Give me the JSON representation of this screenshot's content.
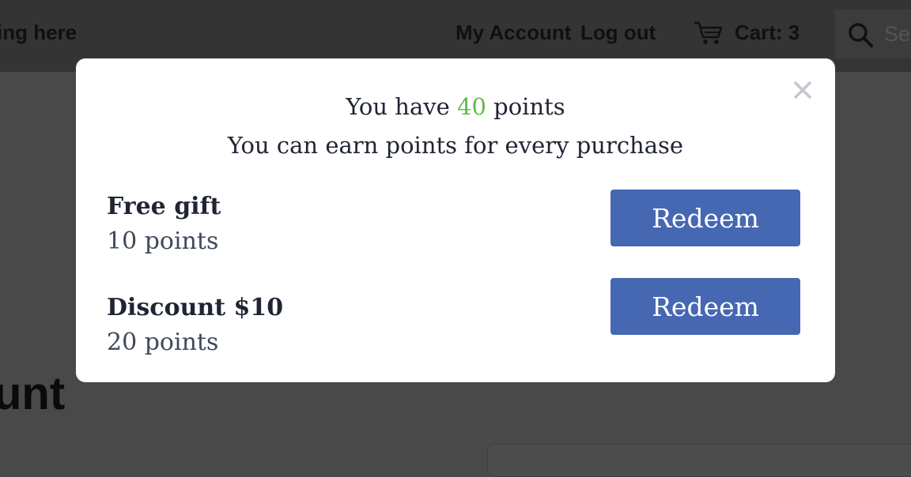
{
  "header": {
    "brand_fragment": "ing here",
    "my_account": "My Account",
    "log_out": "Log out",
    "cart_label": "Cart: 3",
    "search_placeholder": "Sea"
  },
  "page": {
    "heading_fragment": "unt"
  },
  "modal": {
    "headline_prefix": "You have ",
    "points_balance": "40",
    "headline_suffix": " points",
    "subline": "You can earn points for every purchase",
    "rewards": [
      {
        "title": "Free gift",
        "cost": "10 points",
        "button": "Redeem"
      },
      {
        "title": "Discount $10",
        "cost": "20 points",
        "button": "Redeem"
      }
    ]
  },
  "colors": {
    "accent_button": "#4668b3",
    "points_highlight": "#5fbb4e",
    "overlay_background": "#494949"
  },
  "icons": {
    "cart": "cart-icon",
    "search": "search-icon",
    "close": "close-icon"
  }
}
